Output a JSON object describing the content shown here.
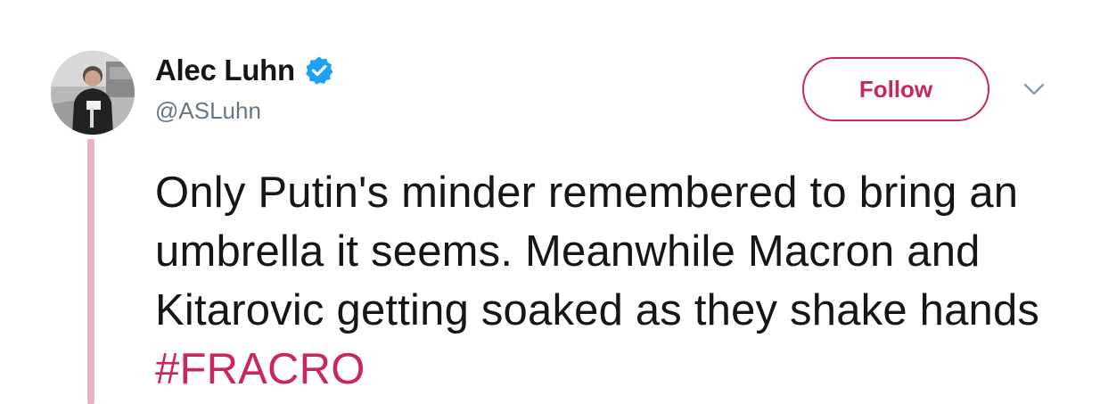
{
  "author": {
    "display_name": "Alec Luhn",
    "handle": "@ASLuhn",
    "verified": true,
    "avatar_icon": "user-photo-avatar"
  },
  "actions": {
    "follow_label": "Follow",
    "more_icon": "chevron-down-icon"
  },
  "tweet": {
    "text": "Only Putin's minder remembered to bring an umbrella it seems. Meanwhile Macron and Kitarovic getting soaked as they shake hands ",
    "hashtag": "#FRACRO"
  },
  "colors": {
    "accent": "#c9285a",
    "thread_line": "#e9b3c5",
    "verified": "#1da1f2",
    "text_primary": "#14171a",
    "text_secondary": "#657786"
  }
}
